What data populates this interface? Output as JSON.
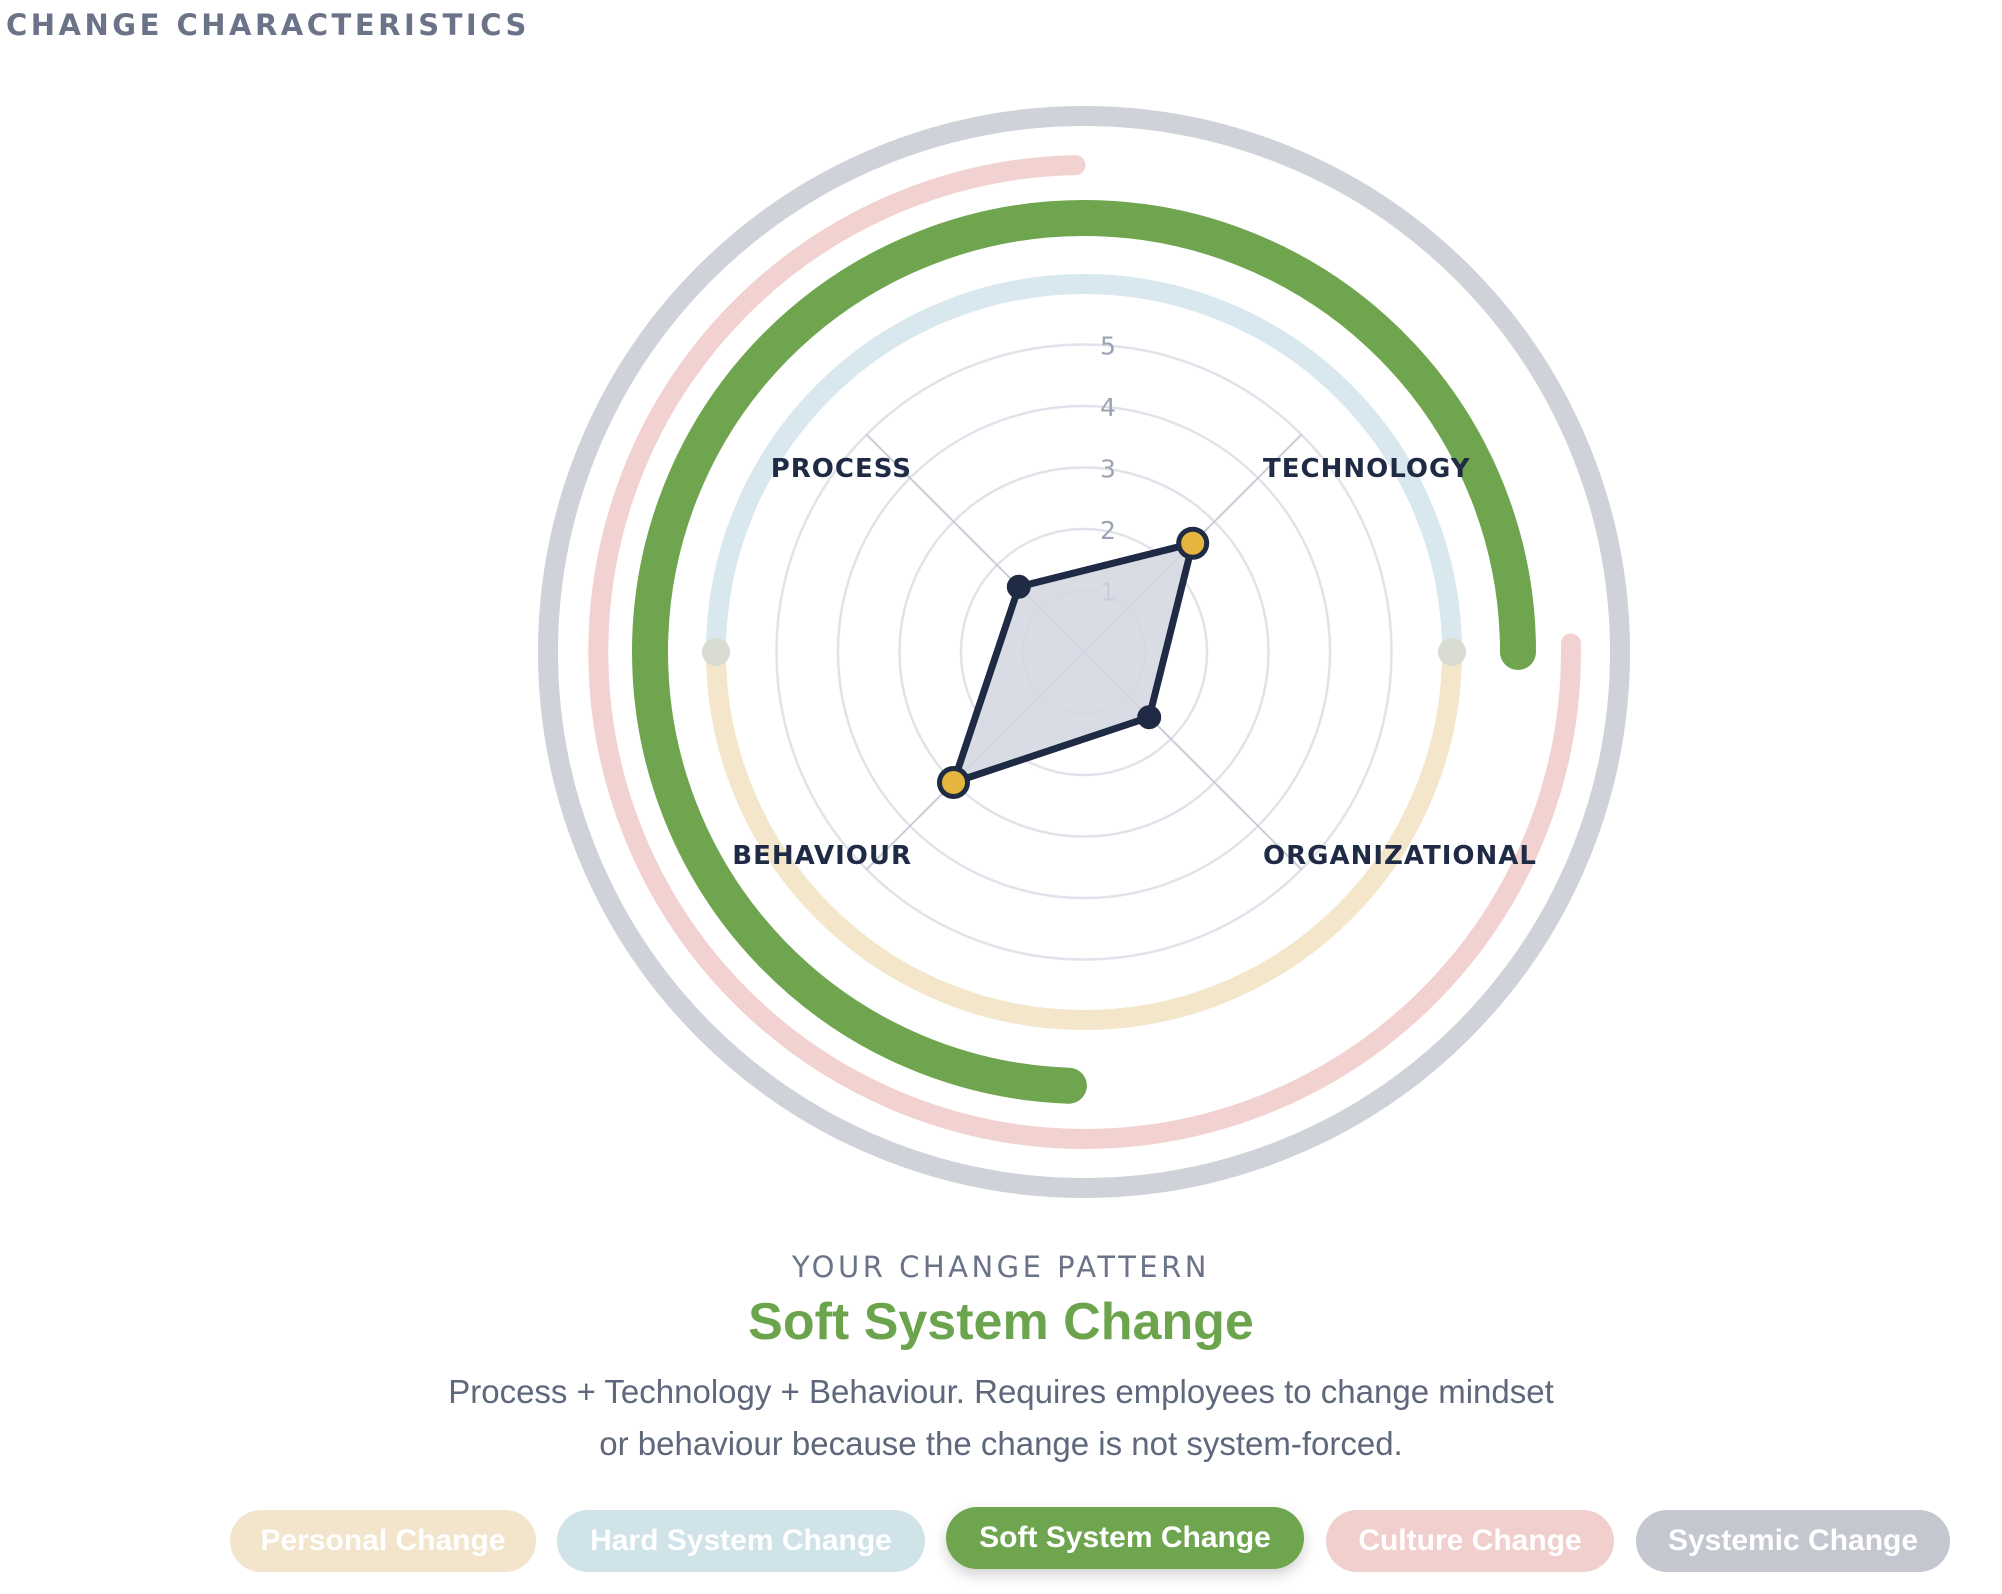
{
  "header": {
    "title": "CHANGE CHARACTERISTICS"
  },
  "chart_data": {
    "type": "radar",
    "axes": [
      "TECHNOLOGY",
      "ORGANIZATIONAL",
      "BEHAVIOUR",
      "PROCESS"
    ],
    "scale": [
      1,
      2,
      3,
      4,
      5
    ],
    "range": [
      0,
      5
    ],
    "values": [
      2.5,
      1.5,
      3.0,
      1.5
    ],
    "highlighted_axes": [
      "TECHNOLOGY",
      "BEHAVIOUR"
    ],
    "colors": {
      "fill": "#d3d6e0",
      "stroke": "#1f2a44",
      "point": "#1f2a44",
      "highlight_point": "#e5b53f",
      "grid": "#e2e3ea",
      "spoke": "#c9ccd7"
    },
    "rings": [
      {
        "name": "Personal Change",
        "color": "#f3e6cb",
        "active": false
      },
      {
        "name": "Hard System Change",
        "color": "#d9e8ee",
        "active": false
      },
      {
        "name": "Soft System Change",
        "color": "#6ea54e",
        "active": true
      },
      {
        "name": "Culture Change",
        "color": "#f2d2d0",
        "active": false
      },
      {
        "name": "Systemic Change",
        "color": "#d0d2d9",
        "active": false
      }
    ]
  },
  "pattern": {
    "eyebrow": "YOUR CHANGE PATTERN",
    "name": "Soft System Change",
    "description_line1": "Process + Technology + Behaviour. Requires employees to change mindset",
    "description_line2": "or behaviour because the change is not system-forced."
  },
  "pills": [
    {
      "label": "Personal Change",
      "color": "#f2e5cb",
      "active": false
    },
    {
      "label": "Hard System Change",
      "color": "#cfe3e9",
      "active": false
    },
    {
      "label": "Soft System Change",
      "color": "#6ea54e",
      "active": true
    },
    {
      "label": "Culture Change",
      "color": "#f0cfcd",
      "active": false
    },
    {
      "label": "Systemic Change",
      "color": "#c4c7d0",
      "active": false
    }
  ]
}
